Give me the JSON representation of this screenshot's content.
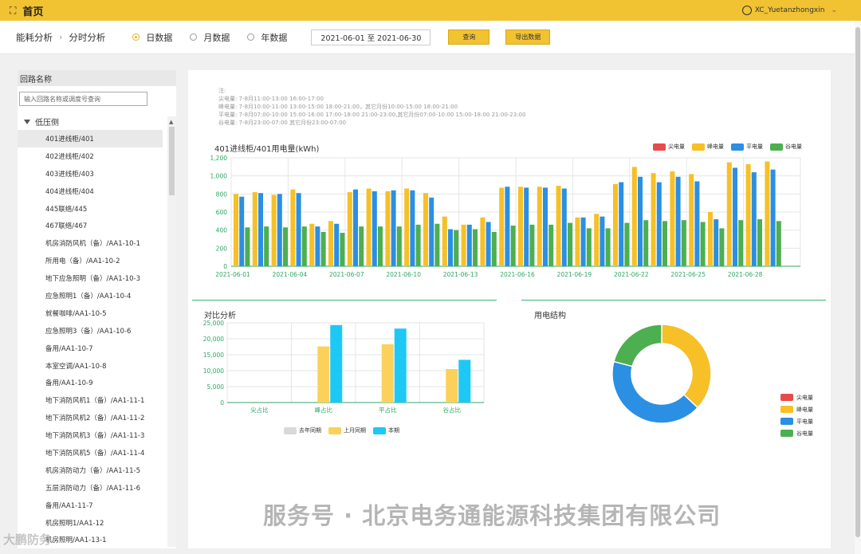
{
  "topbar": {
    "home_label": "首页",
    "expand_glyph": "⛶",
    "username": "XC_Yuetanzhongxin"
  },
  "filter": {
    "breadcrumb": [
      "能耗分析",
      "分时分析"
    ],
    "radios": [
      "日数据",
      "月数据",
      "年数据"
    ],
    "selected_radio": "日数据",
    "date_range": "2021-06-01 至 2021-06-30",
    "query_label": "查询",
    "export_label": "导出数据"
  },
  "sidebar": {
    "title": "回路名称",
    "search_placeholder": "输入回路名称或调度号查询",
    "root": "低压侧",
    "items": [
      "401进线柜/401",
      "402进线柜/402",
      "403进线柜/403",
      "404进线柜/404",
      "445联络/445",
      "467联络/467",
      "机房消防风机（备）/AA1-10-1",
      "所用电（备）/AA1-10-2",
      "地下应急照明（备）/AA1-10-3",
      "应急照明1（备）/AA1-10-4",
      "就餐咖啡/AA1-10-5",
      "应急照明3（备）/AA1-10-6",
      "备用/AA1-10-7",
      "本室空调/AA1-10-8",
      "备用/AA1-10-9",
      "地下消防风机1（备）/AA1-11-1",
      "地下消防风机2（备）/AA1-11-2",
      "地下消防风机3（备）/AA1-11-3",
      "地下消防风机5（备）/AA1-11-4",
      "机房消防动力（备）/AA1-11-5",
      "五层消防动力（备）/AA1-11-6",
      "备用/AA1-11-7",
      "机房照明1/AA1-12",
      "机房照明/AA1-13-1"
    ],
    "selected_index": 0
  },
  "notes": {
    "heading": "注:",
    "lines": [
      "尖电量: 7-8月11:00-13:00 16:00-17:00",
      "峰电量: 7-8月10:00-11:00 13:00-15:00 18:00-21:00，其它月份10:00-15:00 18:00-21:00",
      "平电量: 7-8月07:00-10:00 15:00-16:00 17:00-18:00 21:00-23:00,其它月份07:00-10:00 15:00-18:00 21:00-23:00",
      "谷电量: 7-8月23:00-07:00 其它月份23:00-07:00"
    ]
  },
  "colors": {
    "jian": "#e84b4b",
    "feng": "#f6c026",
    "ping": "#2b8fe3",
    "gu": "#4caf50",
    "last_year": "#d9d9d9",
    "last_period": "#fbd15b",
    "current": "#1ec8f5",
    "accent": "#f1c232",
    "green_line": "#3bb37b"
  },
  "chart_data": [
    {
      "type": "bar",
      "title": "401进线柜/401用电量(kWh)",
      "categories": [
        "2021-06-01",
        "2021-06-02",
        "2021-06-03",
        "2021-06-04",
        "2021-06-05",
        "2021-06-06",
        "2021-06-07",
        "2021-06-08",
        "2021-06-09",
        "2021-06-10",
        "2021-06-11",
        "2021-06-12",
        "2021-06-13",
        "2021-06-14",
        "2021-06-15",
        "2021-06-16",
        "2021-06-17",
        "2021-06-18",
        "2021-06-19",
        "2021-06-20",
        "2021-06-21",
        "2021-06-22",
        "2021-06-23",
        "2021-06-24",
        "2021-06-25",
        "2021-06-26",
        "2021-06-27",
        "2021-06-28",
        "2021-06-29",
        "2021-06-30"
      ],
      "tick_labels": [
        "2021-06-01",
        "2021-06-04",
        "2021-06-07",
        "2021-06-10",
        "2021-06-13",
        "2021-06-16",
        "2021-06-19",
        "2021-06-22",
        "2021-06-25",
        "2021-06-28"
      ],
      "series": [
        {
          "name": "尖电量",
          "values": [
            0,
            0,
            0,
            0,
            0,
            0,
            0,
            0,
            0,
            0,
            0,
            0,
            0,
            0,
            0,
            0,
            0,
            0,
            0,
            0,
            0,
            0,
            0,
            0,
            0,
            0,
            0,
            0,
            0,
            0
          ]
        },
        {
          "name": "峰电量",
          "values": [
            800,
            820,
            790,
            850,
            470,
            500,
            820,
            860,
            830,
            860,
            810,
            550,
            460,
            540,
            870,
            880,
            880,
            890,
            540,
            580,
            910,
            1100,
            1030,
            1050,
            1020,
            600,
            1150,
            1130,
            1160,
            0
          ]
        },
        {
          "name": "平电量",
          "values": [
            770,
            810,
            800,
            810,
            440,
            470,
            850,
            830,
            840,
            840,
            760,
            410,
            460,
            490,
            880,
            870,
            870,
            860,
            540,
            550,
            930,
            990,
            930,
            990,
            940,
            520,
            1090,
            1040,
            1070,
            0
          ]
        },
        {
          "name": "谷电量",
          "values": [
            430,
            440,
            430,
            440,
            380,
            370,
            440,
            440,
            440,
            460,
            470,
            400,
            410,
            380,
            450,
            460,
            460,
            480,
            420,
            420,
            480,
            510,
            500,
            510,
            490,
            420,
            510,
            520,
            500,
            0
          ]
        }
      ],
      "ylim": [
        0,
        1200
      ],
      "yticks": [
        0,
        200,
        400,
        600,
        800,
        1000,
        1200
      ],
      "ytick_labels": [
        "0",
        "200",
        "400",
        "600",
        "800",
        "1,000",
        "1,200"
      ],
      "grid": true,
      "legend_position": "top-right"
    },
    {
      "type": "bar",
      "title": "对比分析",
      "categories": [
        "尖占比",
        "峰占比",
        "平占比",
        "谷占比"
      ],
      "series": [
        {
          "name": "去年同期",
          "values": [
            0,
            0,
            0,
            0
          ]
        },
        {
          "name": "上月同期",
          "values": [
            0,
            17600,
            18300,
            10500
          ]
        },
        {
          "name": "本期",
          "values": [
            0,
            24300,
            23200,
            13400
          ]
        }
      ],
      "ylim": [
        0,
        25000
      ],
      "yticks": [
        0,
        5000,
        10000,
        15000,
        20000,
        25000
      ],
      "ytick_labels": [
        "0",
        "5,000",
        "10,000",
        "15,000",
        "20,000",
        "25,000"
      ],
      "grid": true,
      "legend_position": "bottom"
    },
    {
      "type": "pie",
      "title": "用电结构",
      "donut": true,
      "labels": [
        "尖电量",
        "峰电量",
        "平电量",
        "谷电量"
      ],
      "values": [
        0,
        37,
        42,
        21
      ],
      "legend_position": "bottom-right"
    }
  ],
  "watermark": {
    "main": "服务号 · 北京电务通能源科技集团有限公司",
    "small": "大鹏防务"
  }
}
